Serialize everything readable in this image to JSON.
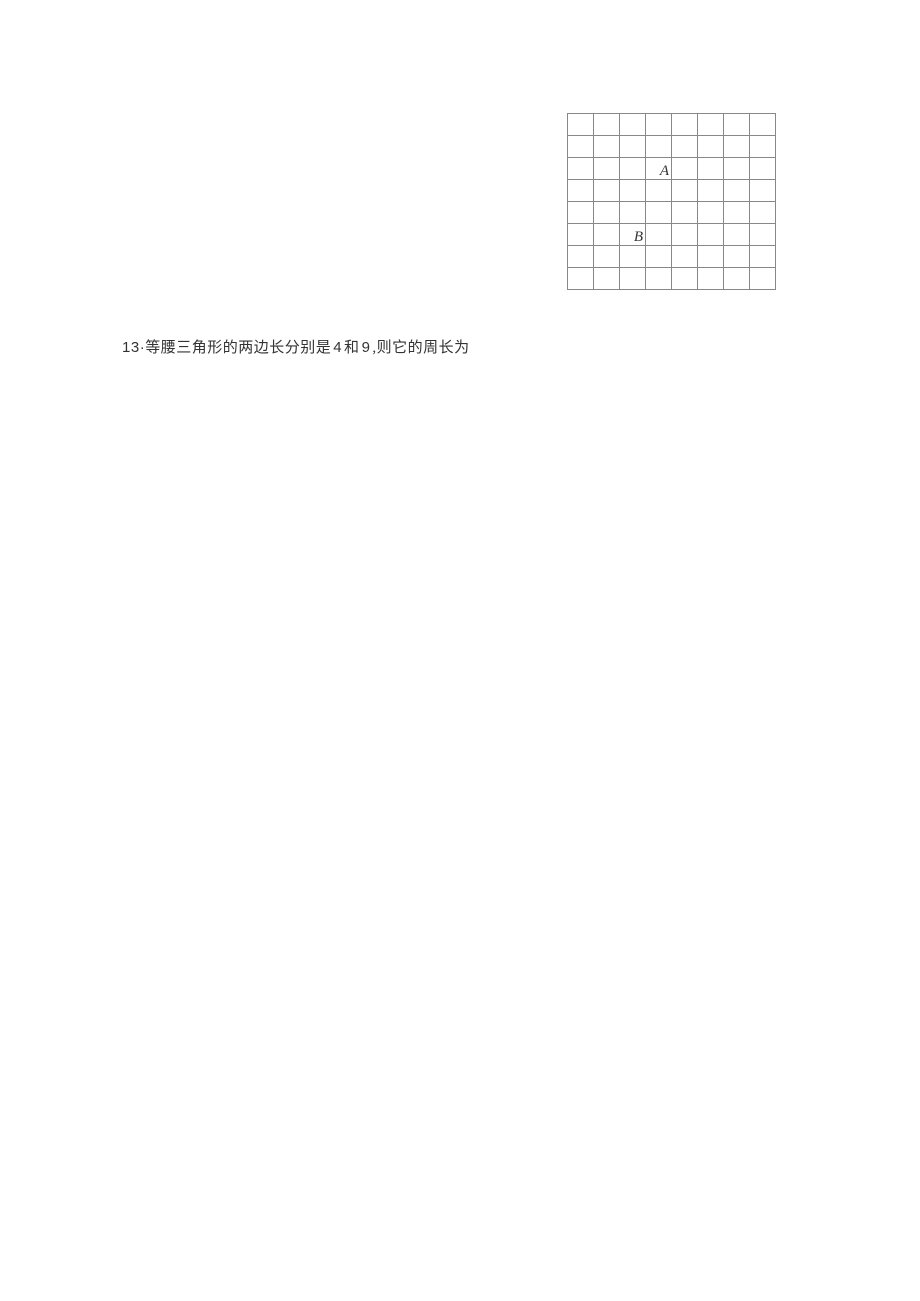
{
  "grid": {
    "rows": 8,
    "cols": 8,
    "labelA": "A",
    "labelB": "B",
    "posA": {
      "row": 2,
      "col": 3
    },
    "posB": {
      "row": 5,
      "col": 2
    }
  },
  "question": {
    "number": "13",
    "separator": "·",
    "text_part1": "等腰三角形的两边长分别是",
    "value1": "4",
    "connector": "和",
    "value2": "9",
    "comma": ",",
    "text_part2": "则它的周长为"
  }
}
